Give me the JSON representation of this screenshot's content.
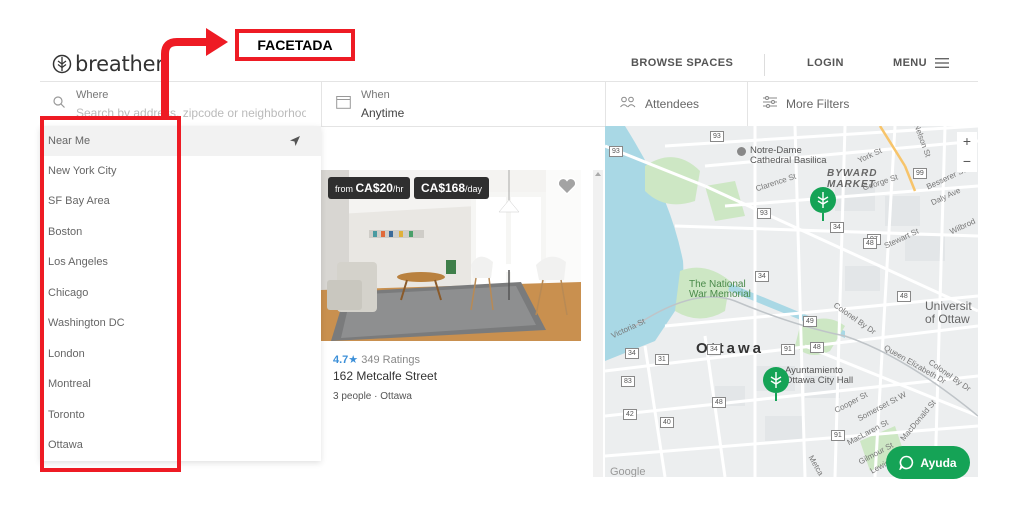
{
  "header": {
    "logo_text": "breather",
    "nav": {
      "browse": "BROWSE SPACES",
      "login": "LOGIN",
      "menu": "MENU"
    }
  },
  "search": {
    "where_label": "Where",
    "where_placeholder": "Search by address, zipcode or neighborhood",
    "when_label": "When",
    "when_value": "Anytime",
    "attendees_label": "Attendees",
    "filters_label": "More Filters"
  },
  "dropdown": {
    "items": [
      "Near Me",
      "New York City",
      "SF Bay Area",
      "Boston",
      "Los Angeles",
      "Chicago",
      "Washington DC",
      "London",
      "Montreal",
      "Toronto",
      "Ottawa"
    ]
  },
  "listing": {
    "price_hour_prefix": "from",
    "price_hour": "CA$20",
    "price_hour_unit": "/hr",
    "price_day": "CA$168",
    "price_day_unit": "/day",
    "rating": "4.7",
    "ratings_count": "349 Ratings",
    "title": "162 Metcalfe Street",
    "capacity": "3 people",
    "city": "Ottawa"
  },
  "map": {
    "city_label": "Ottawa",
    "labels": {
      "notre_dame": "Notre-Dame\nCathedral Basilica",
      "byward": "BYWARD\nMARKET",
      "war_memorial": "The National\nWar Memorial",
      "university": "Universit\nof Ottaw",
      "city_hall": "Ayuntamiento\nOttawa City Hall",
      "york_st": "York St",
      "clarence_st": "Clarence St",
      "george_st": "George St",
      "nelson_st": "Nelson St",
      "besserer_st": "Besserer St",
      "daly_ave": "Daly Ave",
      "stewart_st": "Stewart St",
      "wilbrod": "Wilbrod",
      "colonel_by": "Colonel By Dr",
      "queen_elizabeth": "Queen Elizabeth Dr",
      "victoria_st": "Victoria St",
      "cooper_st": "Cooper St",
      "somerset_st": "Somerset St W",
      "macdonald_st": "MacDonald St",
      "maclaren_st": "MacLaren St",
      "gilmour_st": "Gilmour St",
      "lewis_st": "Lewis St",
      "metcalfe": "Metca",
      "google": "Google"
    },
    "shields": [
      "93",
      "34",
      "93",
      "97",
      "34",
      "48",
      "49",
      "34",
      "91",
      "48",
      "31",
      "34",
      "83",
      "42",
      "48",
      "40",
      "91",
      "99",
      "48",
      "93"
    ],
    "zoom_in": "+",
    "zoom_out": "−"
  },
  "help_button": "Ayuda",
  "annotation": {
    "title": "FACETADA"
  },
  "colors": {
    "accent": "#15a356",
    "annotation": "#ee1b24",
    "water": "#a9d8e5",
    "park": "#cde7c4"
  }
}
